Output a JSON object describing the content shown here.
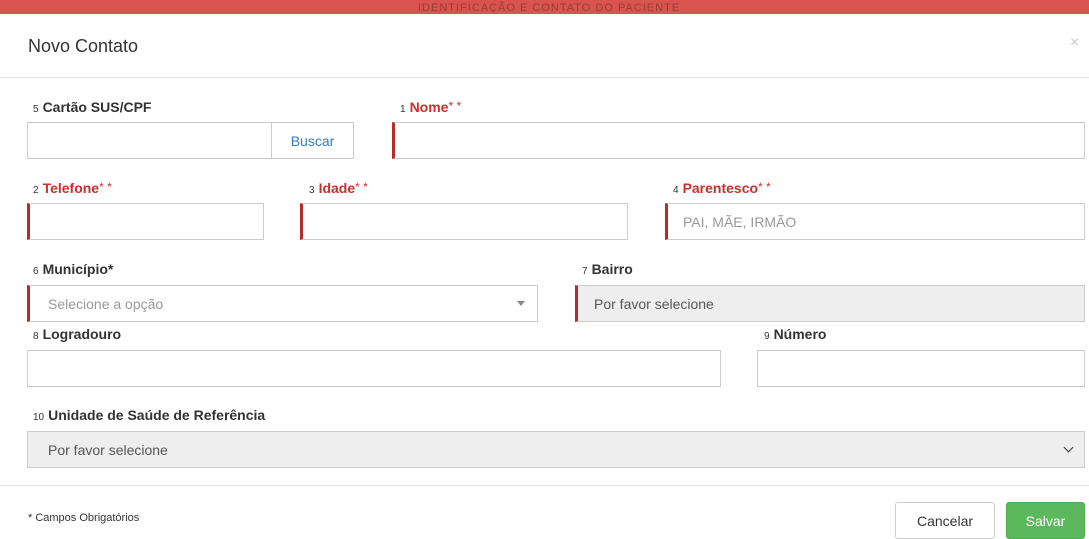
{
  "modal": {
    "title": "Novo Contato",
    "close_symbol": "×",
    "background_banner": "IDENTIFICAÇÃO E CONTATO DO PACIENTE"
  },
  "colors": {
    "banner_red": "#d9534f",
    "required_red": "#c9302c",
    "link_blue": "#337ab7",
    "save_green": "#5cb85c"
  },
  "fields": {
    "cartao": {
      "num": "5",
      "label": "Cartão SUS/CPF",
      "value": "",
      "button": "Buscar"
    },
    "nome": {
      "num": "1",
      "label": "Nome",
      "req": "* *",
      "value": ""
    },
    "telefone": {
      "num": "2",
      "label": "Telefone",
      "req": "* *",
      "value": ""
    },
    "idade": {
      "num": "3",
      "label": "Idade",
      "req": "* *",
      "value": ""
    },
    "parentesco": {
      "num": "4",
      "label": "Parentesco",
      "req": "* *",
      "value": "",
      "placeholder": "PAI, MÃE, IRMÃO"
    },
    "municipio": {
      "num": "6",
      "label": "Município*",
      "selected": "Selecione a opção"
    },
    "bairro": {
      "num": "7",
      "label": "Bairro",
      "value": "Por favor selecione"
    },
    "logradouro": {
      "num": "8",
      "label": "Logradouro",
      "value": ""
    },
    "numero": {
      "num": "9",
      "label": "Número",
      "value": ""
    },
    "unidade": {
      "num": "10",
      "label": "Unidade de Saúde de Referência",
      "selected": "Por favor selecione"
    }
  },
  "footer": {
    "note": "* Campos Obrigatórios",
    "cancel": "Cancelar",
    "save": "Salvar"
  },
  "icons": {
    "close": "close-icon",
    "select_arrow": "caret-down-icon",
    "select_chevron": "chevron-down-icon"
  }
}
